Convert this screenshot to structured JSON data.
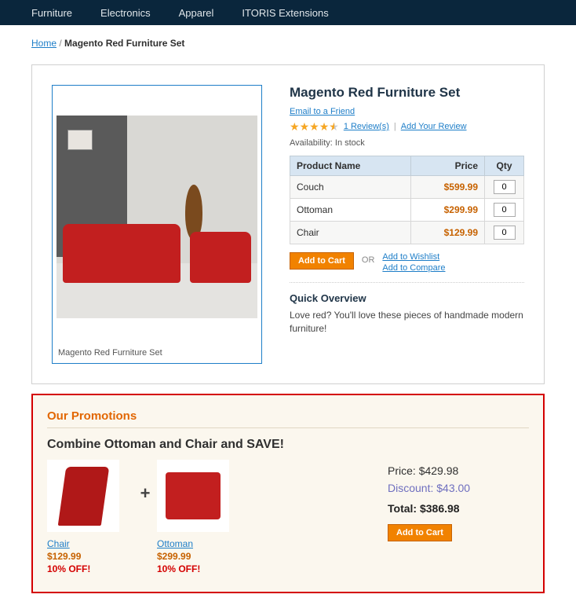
{
  "nav": {
    "items": [
      "Furniture",
      "Electronics",
      "Apparel",
      "ITORIS Extensions"
    ]
  },
  "breadcrumb": {
    "home": "Home",
    "sep": "/",
    "current": "Magento Red Furniture Set"
  },
  "product": {
    "title": "Magento Red Furniture Set",
    "email_link": "Email to a Friend",
    "reviews_link": "1 Review(s)",
    "add_review_link": "Add Your Review",
    "availability_label": "Availability:",
    "availability_value": "In stock",
    "image_caption": "Magento Red Furniture Set"
  },
  "option_table": {
    "headers": {
      "name": "Product Name",
      "price": "Price",
      "qty": "Qty"
    },
    "rows": [
      {
        "name": "Couch",
        "price": "$599.99",
        "qty": "0"
      },
      {
        "name": "Ottoman",
        "price": "$299.99",
        "qty": "0"
      },
      {
        "name": "Chair",
        "price": "$129.99",
        "qty": "0"
      }
    ]
  },
  "cart": {
    "add_to_cart": "Add to Cart",
    "or": "OR",
    "wishlist": "Add to Wishlist",
    "compare": "Add to Compare"
  },
  "overview": {
    "heading": "Quick Overview",
    "text": "Love red? You'll love these pieces of handmade modern furniture!"
  },
  "promo": {
    "heading": "Our Promotions",
    "subheading": "Combine Ottoman and Chair and SAVE!",
    "items": [
      {
        "name": "Chair",
        "price": "$129.99",
        "discount": "10% OFF!"
      },
      {
        "name": "Ottoman",
        "price": "$299.99",
        "discount": "10% OFF!"
      }
    ],
    "plus": "+",
    "price_label": "Price:",
    "price_value": "$429.98",
    "discount_label": "Discount:",
    "discount_value": "$43.00",
    "total_label": "Total:",
    "total_value": "$386.98",
    "add_to_cart": "Add to Cart"
  }
}
